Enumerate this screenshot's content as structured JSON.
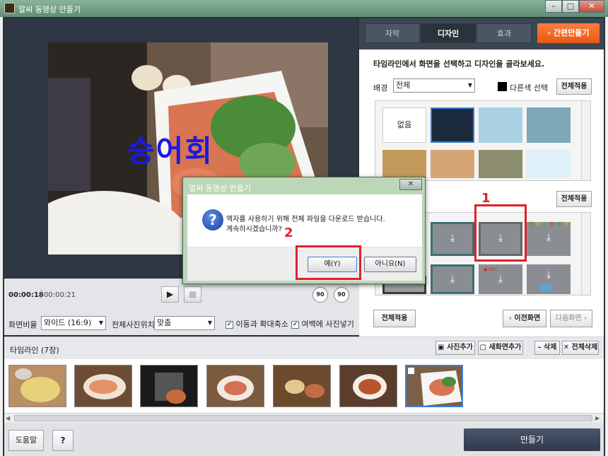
{
  "window": {
    "title": "알씨 동영상 만들기",
    "min": "–",
    "max": "□",
    "close": "✕"
  },
  "preview": {
    "caption": "숭어회",
    "time_current": "00:00:18",
    "time_total": "00:00:21"
  },
  "controls": {
    "play": "▶",
    "stop": "■",
    "rot_left": "90",
    "rot_right": "90",
    "aspect_label": "화면비율",
    "aspect_value": "와이드 (16:9)",
    "photo_pos_label": "전체사진위치",
    "photo_pos_value": "맞춤",
    "move_zoom": "이동과 확대축소",
    "fill_margin": "여백에 사진넣기"
  },
  "tabs": {
    "caption": "자막",
    "design": "디자인",
    "effect": "효과",
    "quick": "간편만들기"
  },
  "design_panel": {
    "instruction": "타임라인에서 화면을 선택하고 디자인을 골라보세요.",
    "bg_label": "배경",
    "bg_select": "전체",
    "other_color": "다른색 선택",
    "apply_all_1": "전체적용",
    "none_label": "없음",
    "apply_all_2": "전체적용",
    "apply_all_3": "전체적용",
    "prev_screen": "이전화면",
    "next_screen": "다음화면",
    "rec_label": "● REC"
  },
  "timeline": {
    "label": "타임라인 (7장)",
    "add_photo": "사진추가",
    "new_screen": "새화면추가",
    "delete": "삭제",
    "delete_all": "전체삭제"
  },
  "footer": {
    "help": "도움말",
    "question": "?",
    "make": "만들기"
  },
  "dialog": {
    "title": "알씨 동영상 만들기",
    "close": "✕",
    "line1": "액자를 사용하기 위해 전체 파일을 다운로드 받습니다.",
    "line2": "계속하시겠습니까?",
    "yes": "예(Y)",
    "no": "아니요(N)"
  },
  "annotations": {
    "n1": "1",
    "n2": "2"
  },
  "colors": {
    "accent": "#e35a17",
    "annotation_red": "#e2202a",
    "caption_blue": "#1a1ae0"
  }
}
